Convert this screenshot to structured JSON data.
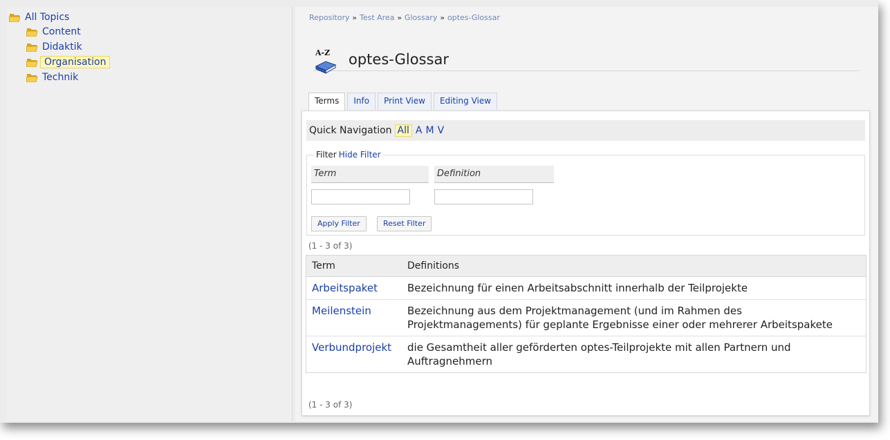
{
  "tree": {
    "root": "All Topics",
    "items": [
      "Content",
      "Didaktik",
      "Organisation",
      "Technik"
    ],
    "selected": "Organisation"
  },
  "breadcrumb": [
    "Repository",
    "Test Area",
    "Glossary",
    "optes-Glossar"
  ],
  "breadcrumb_separator": "»",
  "title_icon_text": "A-Z",
  "page_title": "optes-Glossar",
  "tabs": [
    {
      "label": "Terms",
      "active": true
    },
    {
      "label": "Info",
      "active": false
    },
    {
      "label": "Print View",
      "active": false
    },
    {
      "label": "Editing View",
      "active": false
    }
  ],
  "quick_navigation": {
    "label": "Quick Navigation",
    "letters": [
      "All",
      "A",
      "M",
      "V"
    ],
    "selected": "All"
  },
  "filter": {
    "legend": "Filter",
    "hide_link": "Hide Filter",
    "term_label": "Term",
    "definition_label": "Definition",
    "term_value": "",
    "definition_value": "",
    "apply_label": "Apply Filter",
    "reset_label": "Reset Filter"
  },
  "result_count": "(1 - 3 of 3)",
  "table": {
    "headers": [
      "Term",
      "Definitions"
    ],
    "rows": [
      {
        "term": "Arbeitspaket",
        "definition": "Bezeichnung für einen Arbeitsabschnitt innerhalb der Teilprojekte"
      },
      {
        "term": "Meilenstein",
        "definition": "Bezeichnung aus dem Projektmanagement (und im Rahmen des Projektmanagements) für geplante Ergebnisse einer oder mehrerer Arbeitspakete"
      },
      {
        "term": "Verbundprojekt",
        "definition": "die Gesamtheit aller geförderten optes-Teilprojekte mit allen Partnern und Auftragnehmern"
      }
    ]
  },
  "colors": {
    "link": "#1a3fa8",
    "highlight": "#fff7b8",
    "folder": "#f2c94c"
  }
}
